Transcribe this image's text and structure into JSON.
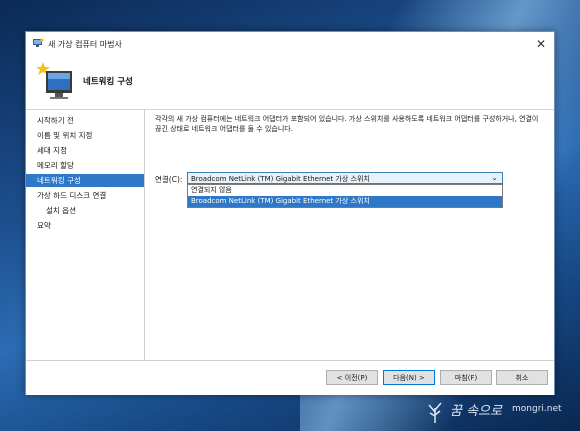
{
  "window": {
    "title": "새 가상 컴퓨터 마법사"
  },
  "header": {
    "title": "네트워킹 구성"
  },
  "nav": {
    "items": [
      {
        "label": "시작하기 전",
        "selected": false,
        "sub": false
      },
      {
        "label": "이름 및 위치 지정",
        "selected": false,
        "sub": false
      },
      {
        "label": "세대 지정",
        "selected": false,
        "sub": false
      },
      {
        "label": "메모리 할당",
        "selected": false,
        "sub": false
      },
      {
        "label": "네트워킹 구성",
        "selected": true,
        "sub": false
      },
      {
        "label": "가상 하드 디스크 연결",
        "selected": false,
        "sub": false
      },
      {
        "label": "설치 옵션",
        "selected": false,
        "sub": true
      },
      {
        "label": "요약",
        "selected": false,
        "sub": false
      }
    ]
  },
  "content": {
    "description": "각각의 새 가상 컴퓨터에는 네트워크 어댑터가 포함되어 있습니다. 가상 스위치를 사용하도록 네트워크 어댑터를 구성하거나, 연결이 끊긴 상태로 네트워크 어댑터를 둘 수 있습니다.",
    "connection_label": "연결(C):",
    "connection_value": "Broadcom NetLink (TM) Gigabit Ethernet 가상 스위치",
    "options": [
      "연결되지 않음",
      "Broadcom NetLink (TM) Gigabit Ethernet 가상 스위치"
    ],
    "highlighted_option": 1
  },
  "footer": {
    "prev": "< 이전(P)",
    "next": "다음(N) >",
    "finish": "마침(F)",
    "cancel": "취소"
  },
  "watermark": {
    "text": "꿈 속으로",
    "sub": "mongri.net"
  },
  "colors": {
    "accent": "#2e78c7",
    "select_bg": "#e5f1fb"
  }
}
